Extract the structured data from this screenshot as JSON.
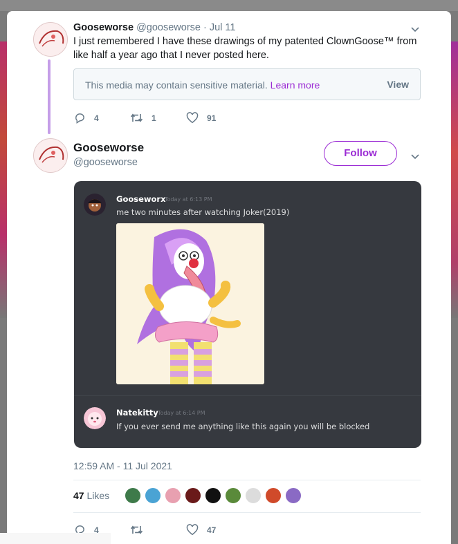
{
  "parent_tweet": {
    "display_name": "Gooseworse",
    "handle": "@gooseworse",
    "date": "· Jul 11",
    "text": "I just remembered I have these drawings of my patented ClownGoose™ from like half a year ago that I never posted here.",
    "sensitive": {
      "message": "This media may contain sensitive material.",
      "learn_more": "Learn more",
      "view": "View"
    },
    "actions": {
      "replies": "4",
      "retweets": "1",
      "likes": "91"
    }
  },
  "main_tweet": {
    "display_name": "Gooseworse",
    "handle": "@gooseworse",
    "follow_label": "Follow",
    "timestamp": "12:59 AM - 11 Jul 2021",
    "likes_count": "47",
    "likes_label": "Likes",
    "actions": {
      "replies": "4",
      "retweets": "",
      "likes": "47"
    }
  },
  "discord": {
    "messages": [
      {
        "author": "Gooseworx",
        "time": "Today at 6:13 PM",
        "text": "me two minutes after watching Joker(2019)"
      },
      {
        "author": "Natekitty",
        "time": "Today at 6:14 PM",
        "text": "If you ever send me anything like this again you will be blocked"
      }
    ]
  },
  "liker_colors": [
    "#3e7a4a",
    "#4aa3d4",
    "#e8a0b0",
    "#6a1a1a",
    "#111111",
    "#5a8a3a",
    "#dcdcdc",
    "#d04a2a",
    "#8a6ac4"
  ],
  "colors": {
    "accent": "#9b2bd4",
    "thread_line": "#c59ee8",
    "discord_bg": "#36393f"
  }
}
